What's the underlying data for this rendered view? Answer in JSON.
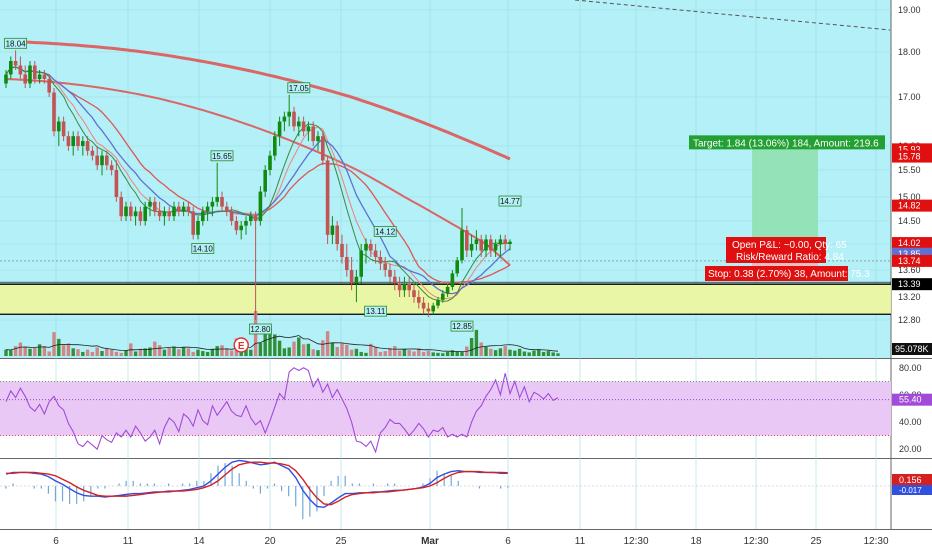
{
  "colors": {
    "plot_bg": "#b3f0f7",
    "up": "#118a11",
    "down": "#c25454",
    "ma_slow": "#e05555",
    "ma_mid": "#e05555",
    "ma_fast": "#f08080",
    "ma_blue": "#6070d0",
    "ma_green": "#3a8a3a",
    "rsi_bg": "#eac8f5",
    "rsi_line": "#a04cd8",
    "macd_line": "#3050e0",
    "signal_line": "#d62020",
    "zone_fill": "#ecf5a0",
    "target_fill": "#8fe0b0",
    "target_label": "#22a033",
    "stop_label": "#e01010",
    "pnl_label": "#e01010"
  },
  "chart_data": {
    "type": "candlestick",
    "price_axis": {
      "range": [
        12.62,
        19.22
      ],
      "ticks": [
        "12.80",
        "13.20",
        "13.60",
        "14.00",
        "14.50",
        "15.00",
        "15.50",
        "16.00",
        "17.00",
        "18.00",
        "19.00"
      ],
      "tick_values": [
        12.8,
        13.2,
        13.6,
        14.0,
        14.5,
        15.0,
        15.5,
        16.0,
        17.0,
        18.0,
        19.0
      ]
    },
    "x_axis": {
      "labels": [
        "6",
        "11",
        "14",
        "20",
        "25",
        "Mar",
        "6",
        "11",
        "12:30",
        "18",
        "12:30",
        "25",
        "12:30"
      ],
      "bar_index": [
        9,
        21,
        33,
        45,
        57,
        72,
        85,
        97,
        106,
        117,
        127,
        137,
        148
      ]
    },
    "price_labels": [
      {
        "text": "15.93",
        "value": 15.93,
        "color": "#e01010"
      },
      {
        "text": "15.78",
        "value": 15.78,
        "color": "#e01010"
      },
      {
        "text": "14.82",
        "value": 14.82,
        "color": "#e01010"
      },
      {
        "text": "14.02",
        "value": 14.02,
        "color": "#e01010"
      },
      {
        "text": "13.85",
        "value": 13.85,
        "color": "#6070d0"
      },
      {
        "text": "13.74",
        "value": 13.74,
        "color": "#e01010"
      },
      {
        "text": "13.39",
        "value": 13.39,
        "color": "#000000"
      }
    ],
    "annotations": [
      {
        "text": "18.04",
        "bar": 2,
        "value": 18.04,
        "pos": "above"
      },
      {
        "text": "17.05",
        "bar": 61,
        "value": 17.05,
        "pos": "above"
      },
      {
        "text": "15.65",
        "bar": 45,
        "value": 15.65,
        "pos": "above"
      },
      {
        "text": "14.10",
        "bar": 41,
        "value": 14.1,
        "pos": "below"
      },
      {
        "text": "14.12",
        "bar": 79,
        "value": 14.12,
        "pos": "above"
      },
      {
        "text": "13.11",
        "bar": 77,
        "value": 13.11,
        "pos": "below"
      },
      {
        "text": "14.77",
        "bar": 105,
        "value": 14.77,
        "pos": "above"
      },
      {
        "text": "12.85",
        "bar": 95,
        "value": 12.85,
        "pos": "below"
      },
      {
        "text": "12.80",
        "bar": 53,
        "value": 12.8,
        "pos": "below"
      }
    ],
    "earnings_marker": {
      "text": "E",
      "bar": 49
    },
    "zone": {
      "top": 13.39,
      "bottom": 12.9
    },
    "position": {
      "entry": 14.02,
      "target": 15.93,
      "stop": 13.64,
      "target_text": "Target: 1.84 (13.06%) 184, Amount: 219.6",
      "stop_text": "Stop: 0.38 (2.70%) 38, Amount: 75.3",
      "pnl_text": "Open P&L: ~0.00, Qty: 65",
      "rr_text": "Risk/Reward Ratio: 4.84"
    },
    "volume_label": "95.078K",
    "rsi": {
      "range": [
        15,
        85
      ],
      "ticks": [
        "20.00",
        "40.00",
        "60.00",
        "80.00"
      ],
      "tick_values": [
        20,
        40,
        60,
        80
      ],
      "upper": 70,
      "mid": 56.5,
      "lower": 30,
      "last_label": "55.40",
      "values": [
        55,
        63,
        58,
        65,
        59,
        51,
        48,
        53,
        46,
        55,
        59,
        52,
        49,
        39,
        33,
        24,
        22,
        26,
        23,
        20,
        30,
        27,
        25,
        32,
        29,
        34,
        29,
        37,
        32,
        26,
        29,
        34,
        24,
        36,
        43,
        40,
        33,
        46,
        43,
        37,
        49,
        41,
        38,
        52,
        45,
        50,
        55,
        48,
        45,
        44,
        52,
        43,
        38,
        41,
        32,
        41,
        51,
        61,
        57,
        77,
        80,
        78,
        80,
        78,
        66,
        72,
        62,
        68,
        58,
        64,
        57,
        50,
        40,
        26,
        25,
        22,
        26,
        18,
        32,
        36,
        42,
        39,
        39,
        35,
        30,
        34,
        39,
        35,
        29,
        34,
        33,
        36,
        29,
        31,
        29,
        31,
        29,
        40,
        48,
        52,
        59,
        64,
        71,
        60,
        76,
        61,
        70,
        58,
        66,
        55,
        62,
        60,
        57,
        61,
        56,
        58
      ]
    },
    "macd": {
      "labels": [
        "0.156",
        "-0.017"
      ],
      "macd": [
        0.14,
        0.16,
        0.16,
        0.16,
        0.15,
        0.14,
        0.11,
        0.06,
        0.02,
        -0.03,
        -0.08,
        -0.11,
        -0.12,
        -0.12,
        -0.13,
        -0.12,
        -0.11,
        -0.1,
        -0.09,
        -0.09,
        -0.08,
        -0.07,
        -0.07,
        -0.06,
        -0.06,
        -0.05,
        -0.04,
        -0.02,
        0.0,
        0.06,
        0.14,
        0.22,
        0.28,
        0.3,
        0.29,
        0.27,
        0.25,
        0.26,
        0.28,
        0.24,
        0.2,
        0.1,
        -0.05,
        -0.16,
        -0.24,
        -0.25,
        -0.2,
        -0.14,
        -0.09,
        -0.09,
        -0.08,
        -0.08,
        -0.07,
        -0.07,
        -0.06,
        -0.05,
        -0.05,
        -0.04,
        -0.03,
        -0.01,
        0.03,
        0.1,
        0.14,
        0.17,
        0.18,
        0.17,
        0.17,
        0.16,
        0.16,
        0.16,
        0.15,
        0.15
      ],
      "signal": [
        0.15,
        0.15,
        0.16,
        0.16,
        0.16,
        0.15,
        0.14,
        0.12,
        0.08,
        0.04,
        -0.01,
        -0.05,
        -0.08,
        -0.11,
        -0.12,
        -0.12,
        -0.12,
        -0.12,
        -0.11,
        -0.1,
        -0.09,
        -0.08,
        -0.07,
        -0.07,
        -0.06,
        -0.06,
        -0.05,
        -0.04,
        -0.02,
        0.01,
        0.06,
        0.13,
        0.2,
        0.25,
        0.27,
        0.28,
        0.28,
        0.27,
        0.27,
        0.26,
        0.24,
        0.18,
        0.08,
        -0.04,
        -0.14,
        -0.21,
        -0.22,
        -0.18,
        -0.13,
        -0.1,
        -0.09,
        -0.08,
        -0.08,
        -0.07,
        -0.07,
        -0.06,
        -0.05,
        -0.04,
        -0.03,
        -0.02,
        0.0,
        0.04,
        0.09,
        0.13,
        0.16,
        0.17,
        0.17,
        0.17,
        0.16,
        0.16,
        0.16,
        0.156
      ]
    },
    "candles": [
      [
        17.3,
        17.6,
        17.2,
        17.5
      ],
      [
        17.5,
        17.9,
        17.4,
        17.8
      ],
      [
        17.8,
        18.04,
        17.6,
        17.7
      ],
      [
        17.7,
        17.9,
        17.4,
        17.5
      ],
      [
        17.5,
        17.7,
        17.2,
        17.3
      ],
      [
        17.3,
        17.8,
        17.2,
        17.7
      ],
      [
        17.7,
        17.8,
        17.3,
        17.4
      ],
      [
        17.4,
        17.6,
        17.3,
        17.5
      ],
      [
        17.5,
        17.6,
        17.3,
        17.4
      ],
      [
        17.4,
        17.5,
        17.0,
        17.1
      ],
      [
        17.1,
        17.2,
        16.2,
        16.3
      ],
      [
        16.3,
        16.6,
        16.0,
        16.5
      ],
      [
        16.5,
        16.6,
        16.1,
        16.2
      ],
      [
        16.2,
        16.3,
        15.9,
        16.0
      ],
      [
        16.0,
        16.3,
        15.8,
        16.2
      ],
      [
        16.2,
        16.3,
        15.9,
        16.0
      ],
      [
        16.0,
        16.2,
        15.8,
        16.1
      ],
      [
        16.1,
        16.2,
        15.8,
        15.9
      ],
      [
        15.9,
        16.0,
        15.7,
        15.8
      ],
      [
        15.8,
        16.0,
        15.5,
        15.6
      ],
      [
        15.6,
        15.9,
        15.4,
        15.8
      ],
      [
        15.8,
        15.9,
        15.5,
        15.6
      ],
      [
        15.6,
        15.7,
        15.4,
        15.5
      ],
      [
        15.5,
        15.7,
        14.9,
        15.0
      ],
      [
        15.0,
        15.1,
        14.5,
        14.6
      ],
      [
        14.6,
        14.9,
        14.5,
        14.8
      ],
      [
        14.8,
        14.9,
        14.5,
        14.6
      ],
      [
        14.6,
        14.8,
        14.4,
        14.7
      ],
      [
        14.7,
        14.8,
        14.4,
        14.5
      ],
      [
        14.5,
        14.9,
        14.4,
        14.8
      ],
      [
        14.8,
        15.0,
        14.6,
        14.9
      ],
      [
        14.9,
        15.0,
        14.6,
        14.7
      ],
      [
        14.7,
        14.9,
        14.5,
        14.6
      ],
      [
        14.6,
        14.8,
        14.4,
        14.7
      ],
      [
        14.7,
        14.8,
        14.5,
        14.6
      ],
      [
        14.6,
        14.9,
        14.5,
        14.8
      ],
      [
        14.8,
        14.9,
        14.6,
        14.7
      ],
      [
        14.7,
        14.9,
        14.6,
        14.8
      ],
      [
        14.8,
        14.9,
        14.6,
        14.7
      ],
      [
        14.7,
        14.8,
        14.1,
        14.2
      ],
      [
        14.2,
        14.6,
        14.1,
        14.5
      ],
      [
        14.5,
        14.8,
        14.4,
        14.7
      ],
      [
        14.7,
        14.9,
        14.5,
        14.8
      ],
      [
        14.8,
        15.0,
        14.6,
        14.9
      ],
      [
        14.9,
        15.65,
        14.8,
        15.0
      ],
      [
        15.0,
        15.1,
        14.7,
        14.8
      ],
      [
        14.8,
        14.9,
        14.6,
        14.7
      ],
      [
        14.7,
        14.8,
        14.4,
        14.5
      ],
      [
        14.5,
        14.6,
        14.2,
        14.3
      ],
      [
        14.3,
        14.5,
        14.1,
        14.4
      ],
      [
        14.4,
        14.6,
        14.2,
        14.5
      ],
      [
        14.5,
        14.7,
        14.4,
        14.6
      ],
      [
        14.6,
        14.7,
        12.8,
        14.5
      ],
      [
        14.5,
        15.2,
        14.4,
        15.1
      ],
      [
        15.1,
        15.6,
        15.0,
        15.5
      ],
      [
        15.5,
        15.9,
        15.4,
        15.8
      ],
      [
        15.8,
        16.3,
        15.7,
        16.2
      ],
      [
        16.2,
        16.6,
        16.0,
        16.5
      ],
      [
        16.5,
        16.7,
        16.3,
        16.6
      ],
      [
        16.6,
        17.05,
        16.4,
        16.7
      ],
      [
        16.7,
        16.8,
        16.3,
        16.4
      ],
      [
        16.4,
        16.6,
        16.2,
        16.5
      ],
      [
        16.5,
        16.6,
        16.2,
        16.3
      ],
      [
        16.3,
        16.5,
        16.1,
        16.4
      ],
      [
        16.4,
        16.5,
        16.0,
        16.1
      ],
      [
        16.1,
        16.3,
        15.9,
        16.2
      ],
      [
        16.2,
        16.3,
        15.6,
        15.7
      ],
      [
        15.7,
        15.8,
        14.0,
        14.2
      ],
      [
        14.2,
        14.6,
        14.0,
        14.4
      ],
      [
        14.4,
        14.5,
        13.9,
        14.0
      ],
      [
        14.0,
        14.2,
        13.7,
        13.8
      ],
      [
        13.8,
        14.0,
        13.5,
        13.6
      ],
      [
        13.6,
        13.8,
        13.3,
        13.4
      ],
      [
        13.4,
        13.6,
        13.11,
        13.5
      ],
      [
        13.5,
        14.0,
        13.4,
        13.9
      ],
      [
        13.9,
        14.12,
        13.7,
        14.0
      ],
      [
        14.0,
        14.1,
        13.8,
        13.9
      ],
      [
        13.9,
        14.0,
        13.7,
        13.8
      ],
      [
        13.8,
        13.9,
        13.6,
        13.7
      ],
      [
        13.7,
        13.8,
        13.5,
        13.6
      ],
      [
        13.6,
        13.7,
        13.4,
        13.5
      ],
      [
        13.5,
        13.6,
        13.3,
        13.4
      ],
      [
        13.4,
        13.5,
        13.2,
        13.3
      ],
      [
        13.3,
        13.5,
        13.2,
        13.4
      ],
      [
        13.4,
        13.5,
        13.2,
        13.3
      ],
      [
        13.3,
        13.4,
        13.1,
        13.2
      ],
      [
        13.2,
        13.3,
        13.0,
        13.1
      ],
      [
        13.1,
        13.2,
        12.9,
        13.0
      ],
      [
        13.0,
        13.1,
        12.85,
        12.95
      ],
      [
        12.95,
        13.1,
        12.9,
        13.05
      ],
      [
        13.05,
        13.2,
        13.0,
        13.15
      ],
      [
        13.15,
        13.3,
        13.1,
        13.25
      ],
      [
        13.25,
        13.4,
        13.2,
        13.35
      ],
      [
        13.35,
        13.6,
        13.3,
        13.55
      ],
      [
        13.55,
        13.8,
        13.5,
        13.75
      ],
      [
        13.75,
        14.77,
        13.7,
        14.3
      ],
      [
        14.3,
        14.4,
        13.8,
        13.9
      ],
      [
        13.9,
        14.2,
        13.8,
        14.0
      ],
      [
        14.0,
        14.3,
        13.9,
        14.1
      ],
      [
        14.1,
        14.2,
        13.8,
        13.9
      ],
      [
        13.9,
        14.2,
        13.8,
        14.1
      ],
      [
        14.1,
        14.2,
        13.8,
        13.9
      ],
      [
        13.9,
        14.1,
        13.8,
        14.0
      ],
      [
        14.0,
        14.2,
        13.8,
        14.1
      ],
      [
        14.1,
        14.2,
        13.9,
        14.0
      ],
      [
        14.0,
        14.1,
        13.9,
        14.05
      ]
    ],
    "volume": [
      14,
      13,
      22,
      30,
      21,
      16,
      18,
      26,
      22,
      10,
      53,
      38,
      24,
      28,
      17,
      15,
      9,
      14,
      9,
      19,
      11,
      18,
      14,
      9,
      7,
      12,
      28,
      10,
      16,
      17,
      19,
      32,
      24,
      14,
      18,
      21,
      15,
      19,
      17,
      9,
      14,
      11,
      9,
      15,
      22,
      24,
      17,
      12,
      39,
      25,
      15,
      14,
      100,
      29,
      71,
      65,
      48,
      34,
      17,
      19,
      32,
      41,
      26,
      27,
      15,
      13,
      35,
      55,
      30,
      20,
      29,
      25,
      14,
      16,
      9,
      7,
      27,
      20,
      9,
      11,
      18,
      22,
      12,
      16,
      13,
      10,
      17,
      9,
      11,
      8,
      7,
      6,
      9,
      13,
      10,
      9,
      21,
      40,
      58,
      30,
      20,
      16,
      13,
      17,
      22,
      14,
      12,
      16,
      10,
      8,
      12,
      15,
      9,
      11,
      8,
      6
    ]
  }
}
